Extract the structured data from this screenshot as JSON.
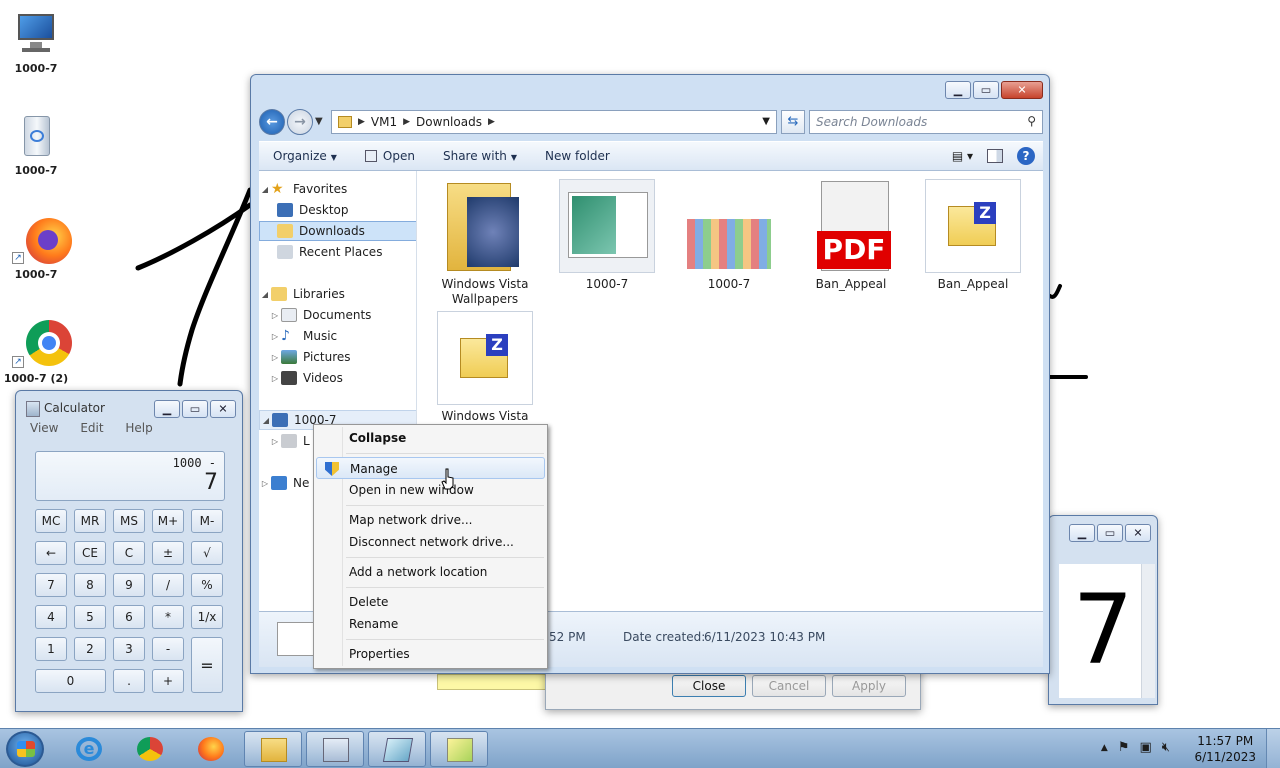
{
  "desktop": {
    "icons": [
      {
        "label": "1000-7",
        "icon": "computer-icon"
      },
      {
        "label": "1000-7",
        "icon": "recycle-bin-icon"
      },
      {
        "label": "1000-7",
        "icon": "firefox-icon"
      },
      {
        "label": "1000-7 (2)",
        "icon": "chrome-icon"
      }
    ]
  },
  "explorer": {
    "breadcrumb": [
      "VM1",
      "Downloads"
    ],
    "search_placeholder": "Search Downloads",
    "toolbar": {
      "organize": "Organize",
      "open": "Open",
      "share_with": "Share with",
      "new_folder": "New folder"
    },
    "nav": {
      "favorites": "Favorites",
      "desktop": "Desktop",
      "downloads": "Downloads",
      "recent_places": "Recent Places",
      "libraries": "Libraries",
      "documents": "Documents",
      "music": "Music",
      "pictures": "Pictures",
      "videos": "Videos",
      "computer": "1000-7",
      "local": "L",
      "network": "Ne"
    },
    "files": [
      {
        "label": "Windows Vista Wallpapers",
        "icon": "folder-icon"
      },
      {
        "label": "1000-7",
        "icon": "image-file-icon"
      },
      {
        "label": "1000-7",
        "icon": "alphabet-image-icon"
      },
      {
        "label": "Ban_Appeal",
        "icon": "pdf-icon"
      },
      {
        "label": "Ban_Appeal",
        "icon": "zip-icon"
      },
      {
        "label": "Windows Vista",
        "icon": "zip-icon"
      }
    ],
    "details": {
      "modified_partial": "52 PM",
      "date_created_label": "Date created:",
      "date_created_value": "6/11/2023 10:43 PM"
    }
  },
  "context_menu": {
    "items": [
      "Collapse",
      "Manage",
      "Open in new window",
      "Map network drive...",
      "Disconnect network drive...",
      "Add a network location",
      "Delete",
      "Rename",
      "Properties"
    ]
  },
  "calculator": {
    "title": "Calculator",
    "menu": [
      "View",
      "Edit",
      "Help"
    ],
    "expression": "1000 -",
    "display": "7",
    "keys": [
      [
        "MC",
        "MR",
        "MS",
        "M+",
        "M-"
      ],
      [
        "←",
        "CE",
        "C",
        "±",
        "√"
      ],
      [
        "7",
        "8",
        "9",
        "/",
        "%"
      ],
      [
        "4",
        "5",
        "6",
        "*",
        "1/x"
      ],
      [
        "1",
        "2",
        "3",
        "-",
        "="
      ],
      [
        "0",
        ".",
        "+"
      ]
    ]
  },
  "properties_dialog": {
    "close": "Close",
    "cancel": "Cancel",
    "apply": "Apply"
  },
  "calculator2": {
    "display": "7"
  },
  "taskbar": {
    "time": "11:57 PM",
    "date": "6/11/2023"
  }
}
